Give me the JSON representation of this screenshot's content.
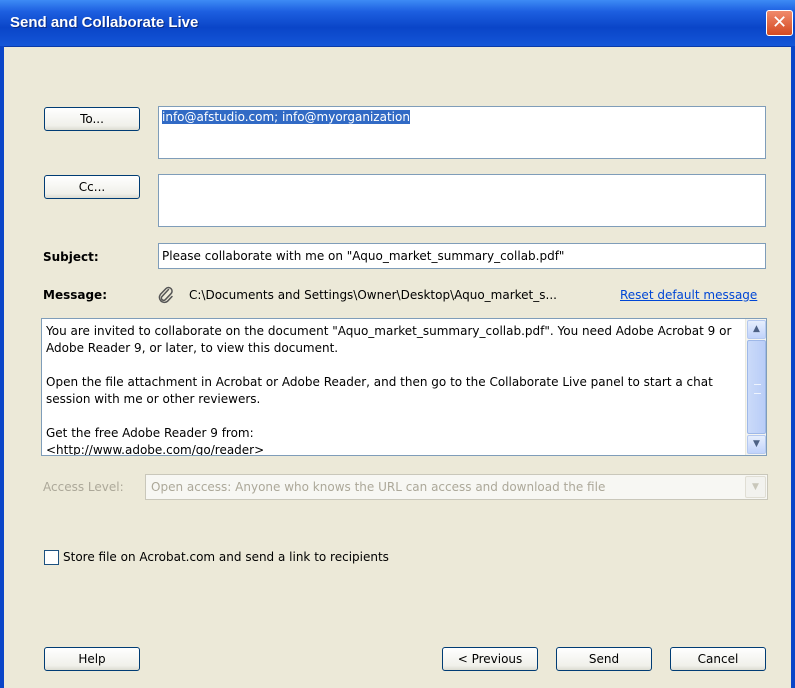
{
  "window": {
    "title": "Send and Collaborate Live",
    "close_glyph": "✕"
  },
  "recipients": {
    "to_button": "To...",
    "to_value": "info@afstudio.com; info@myorganization",
    "cc_button": "Cc...",
    "cc_value": ""
  },
  "subject": {
    "label": "Subject:",
    "value": "Please collaborate with me on \"Aquo_market_summary_collab.pdf\""
  },
  "message": {
    "label": "Message:",
    "attachment_icon": "paperclip-icon",
    "attachment_path": "C:\\Documents and Settings\\Owner\\Desktop\\Aquo_market_s...",
    "reset_link": "Reset default message",
    "body": "You are invited to collaborate on the document \"Aquo_market_summary_collab.pdf\". You need Adobe Acrobat 9 or Adobe Reader 9, or later, to view this document.\n\nOpen the file attachment in Acrobat or Adobe Reader, and then go to the Collaborate Live panel to start a chat session with me or other reviewers.\n\nGet the free Adobe Reader 9 from:\n<http://www.adobe.com/go/reader>"
  },
  "access": {
    "label": "Access Level:",
    "selected": "Open access: Anyone who knows the URL can access and download the file"
  },
  "store_option": {
    "label": "Store file on Acrobat.com and send a link to recipients",
    "checked": false
  },
  "footer": {
    "help": "Help",
    "previous": "< Previous",
    "send": "Send",
    "cancel": "Cancel"
  },
  "colors": {
    "title_bar": "#0a45c8",
    "link": "#0046d5",
    "selection": "#316ac5"
  }
}
